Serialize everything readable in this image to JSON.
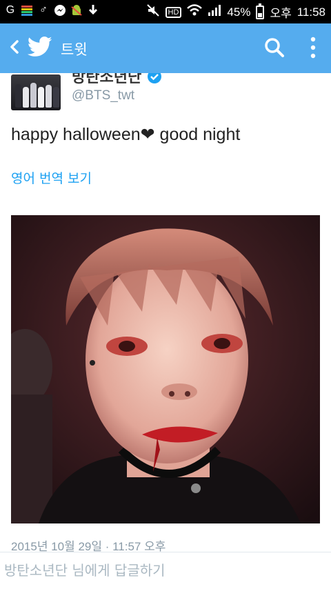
{
  "status_bar": {
    "battery": "45%",
    "ampm": "오후",
    "time": "11:58",
    "battery_level": 0.45
  },
  "app_bar": {
    "title": "트윗",
    "accent": "#55acee"
  },
  "tweet": {
    "author_name": "방탄소년단",
    "author_handle": "@BTS_twt",
    "text": "happy halloween❤ good night",
    "translate_label": "영어 번역 보기",
    "timestamp": "2015년 10월 29일 · 11:57 오후"
  },
  "reply": {
    "placeholder": "방탄소년단 님에게 답글하기"
  },
  "colors": {
    "link": "#1da1f2",
    "muted": "#8899a6"
  }
}
